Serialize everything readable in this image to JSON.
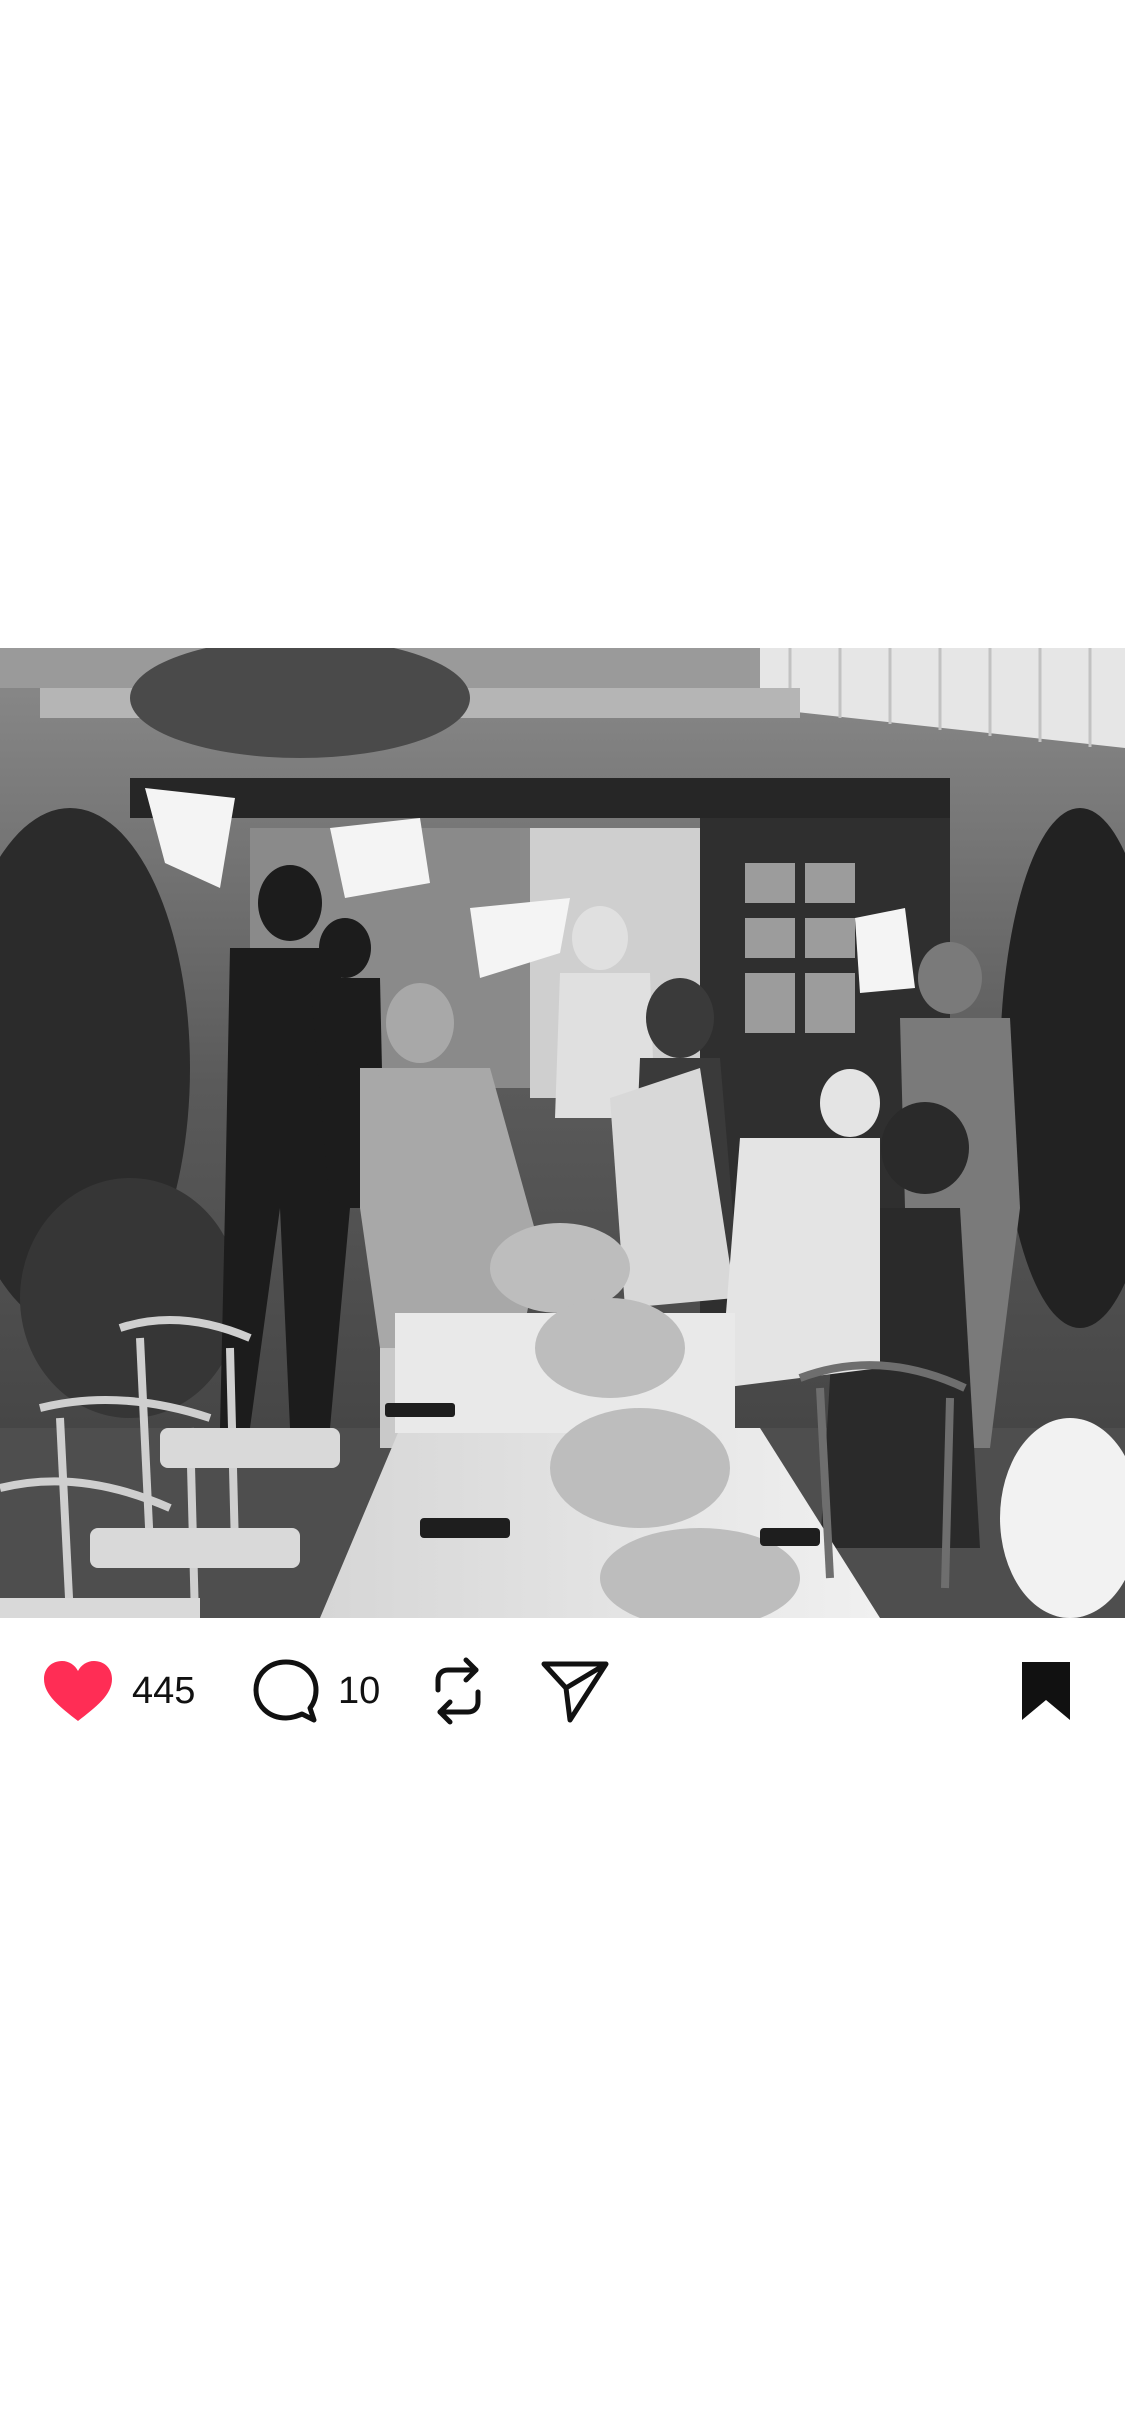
{
  "post": {
    "image": {
      "description_icon": "photo",
      "style": "black-and-white"
    },
    "actions": {
      "like": {
        "icon": "heart-filled-icon",
        "count": "445",
        "color": "#ff2d55",
        "liked": true
      },
      "comment": {
        "icon": "comment-bubble-icon",
        "count": "10"
      },
      "repost": {
        "icon": "repost-icon"
      },
      "share": {
        "icon": "send-icon"
      },
      "bookmark": {
        "icon": "bookmark-filled-icon",
        "saved": true
      }
    }
  }
}
